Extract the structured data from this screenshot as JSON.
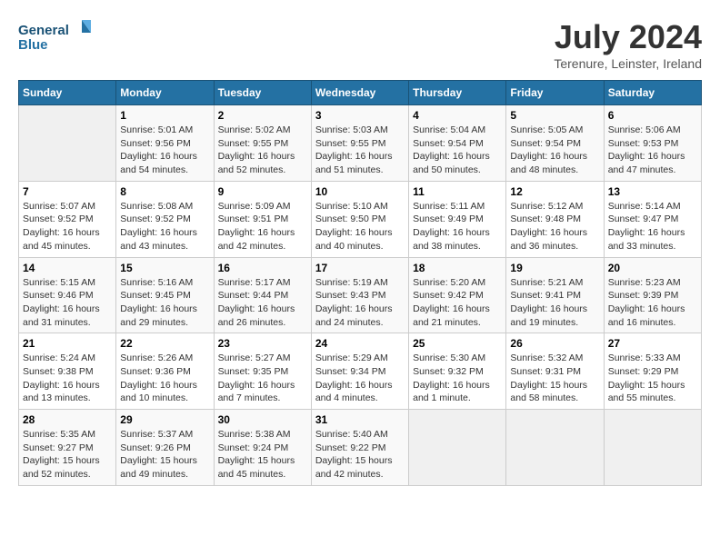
{
  "logo": {
    "line1": "General",
    "line2": "Blue"
  },
  "title": "July 2024",
  "location": "Terenure, Leinster, Ireland",
  "weekdays": [
    "Sunday",
    "Monday",
    "Tuesday",
    "Wednesday",
    "Thursday",
    "Friday",
    "Saturday"
  ],
  "weeks": [
    [
      {
        "day": "",
        "info": ""
      },
      {
        "day": "1",
        "info": "Sunrise: 5:01 AM\nSunset: 9:56 PM\nDaylight: 16 hours\nand 54 minutes."
      },
      {
        "day": "2",
        "info": "Sunrise: 5:02 AM\nSunset: 9:55 PM\nDaylight: 16 hours\nand 52 minutes."
      },
      {
        "day": "3",
        "info": "Sunrise: 5:03 AM\nSunset: 9:55 PM\nDaylight: 16 hours\nand 51 minutes."
      },
      {
        "day": "4",
        "info": "Sunrise: 5:04 AM\nSunset: 9:54 PM\nDaylight: 16 hours\nand 50 minutes."
      },
      {
        "day": "5",
        "info": "Sunrise: 5:05 AM\nSunset: 9:54 PM\nDaylight: 16 hours\nand 48 minutes."
      },
      {
        "day": "6",
        "info": "Sunrise: 5:06 AM\nSunset: 9:53 PM\nDaylight: 16 hours\nand 47 minutes."
      }
    ],
    [
      {
        "day": "7",
        "info": "Sunrise: 5:07 AM\nSunset: 9:52 PM\nDaylight: 16 hours\nand 45 minutes."
      },
      {
        "day": "8",
        "info": "Sunrise: 5:08 AM\nSunset: 9:52 PM\nDaylight: 16 hours\nand 43 minutes."
      },
      {
        "day": "9",
        "info": "Sunrise: 5:09 AM\nSunset: 9:51 PM\nDaylight: 16 hours\nand 42 minutes."
      },
      {
        "day": "10",
        "info": "Sunrise: 5:10 AM\nSunset: 9:50 PM\nDaylight: 16 hours\nand 40 minutes."
      },
      {
        "day": "11",
        "info": "Sunrise: 5:11 AM\nSunset: 9:49 PM\nDaylight: 16 hours\nand 38 minutes."
      },
      {
        "day": "12",
        "info": "Sunrise: 5:12 AM\nSunset: 9:48 PM\nDaylight: 16 hours\nand 36 minutes."
      },
      {
        "day": "13",
        "info": "Sunrise: 5:14 AM\nSunset: 9:47 PM\nDaylight: 16 hours\nand 33 minutes."
      }
    ],
    [
      {
        "day": "14",
        "info": "Sunrise: 5:15 AM\nSunset: 9:46 PM\nDaylight: 16 hours\nand 31 minutes."
      },
      {
        "day": "15",
        "info": "Sunrise: 5:16 AM\nSunset: 9:45 PM\nDaylight: 16 hours\nand 29 minutes."
      },
      {
        "day": "16",
        "info": "Sunrise: 5:17 AM\nSunset: 9:44 PM\nDaylight: 16 hours\nand 26 minutes."
      },
      {
        "day": "17",
        "info": "Sunrise: 5:19 AM\nSunset: 9:43 PM\nDaylight: 16 hours\nand 24 minutes."
      },
      {
        "day": "18",
        "info": "Sunrise: 5:20 AM\nSunset: 9:42 PM\nDaylight: 16 hours\nand 21 minutes."
      },
      {
        "day": "19",
        "info": "Sunrise: 5:21 AM\nSunset: 9:41 PM\nDaylight: 16 hours\nand 19 minutes."
      },
      {
        "day": "20",
        "info": "Sunrise: 5:23 AM\nSunset: 9:39 PM\nDaylight: 16 hours\nand 16 minutes."
      }
    ],
    [
      {
        "day": "21",
        "info": "Sunrise: 5:24 AM\nSunset: 9:38 PM\nDaylight: 16 hours\nand 13 minutes."
      },
      {
        "day": "22",
        "info": "Sunrise: 5:26 AM\nSunset: 9:36 PM\nDaylight: 16 hours\nand 10 minutes."
      },
      {
        "day": "23",
        "info": "Sunrise: 5:27 AM\nSunset: 9:35 PM\nDaylight: 16 hours\nand 7 minutes."
      },
      {
        "day": "24",
        "info": "Sunrise: 5:29 AM\nSunset: 9:34 PM\nDaylight: 16 hours\nand 4 minutes."
      },
      {
        "day": "25",
        "info": "Sunrise: 5:30 AM\nSunset: 9:32 PM\nDaylight: 16 hours\nand 1 minute."
      },
      {
        "day": "26",
        "info": "Sunrise: 5:32 AM\nSunset: 9:31 PM\nDaylight: 15 hours\nand 58 minutes."
      },
      {
        "day": "27",
        "info": "Sunrise: 5:33 AM\nSunset: 9:29 PM\nDaylight: 15 hours\nand 55 minutes."
      }
    ],
    [
      {
        "day": "28",
        "info": "Sunrise: 5:35 AM\nSunset: 9:27 PM\nDaylight: 15 hours\nand 52 minutes."
      },
      {
        "day": "29",
        "info": "Sunrise: 5:37 AM\nSunset: 9:26 PM\nDaylight: 15 hours\nand 49 minutes."
      },
      {
        "day": "30",
        "info": "Sunrise: 5:38 AM\nSunset: 9:24 PM\nDaylight: 15 hours\nand 45 minutes."
      },
      {
        "day": "31",
        "info": "Sunrise: 5:40 AM\nSunset: 9:22 PM\nDaylight: 15 hours\nand 42 minutes."
      },
      {
        "day": "",
        "info": ""
      },
      {
        "day": "",
        "info": ""
      },
      {
        "day": "",
        "info": ""
      }
    ]
  ]
}
